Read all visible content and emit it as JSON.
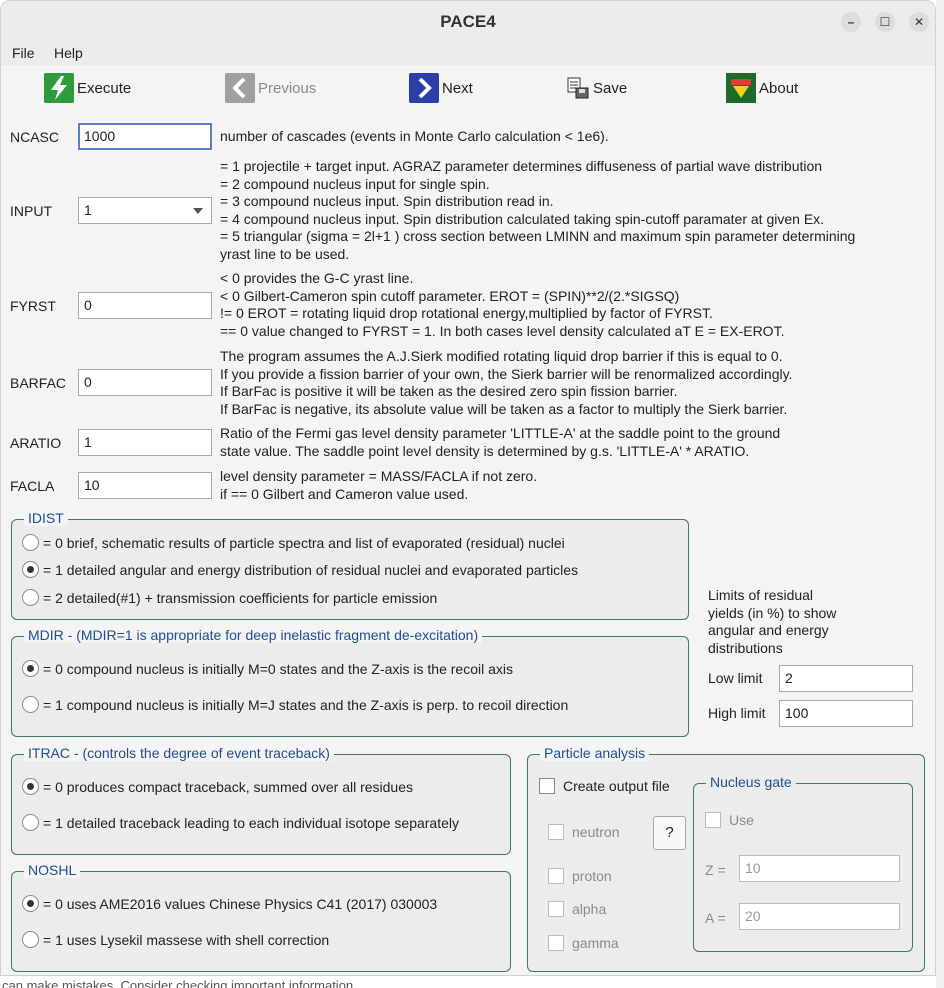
{
  "window": {
    "title": "PACE4",
    "min": "–",
    "max": "☐",
    "close": "✕"
  },
  "menu": {
    "file": "File",
    "help": "Help"
  },
  "toolbar": {
    "execute": "Execute",
    "previous": "Previous",
    "next": "Next",
    "save": "Save",
    "about": "About"
  },
  "params": {
    "ncasc": {
      "label": "NCASC",
      "value": "1000",
      "desc": "number of cascades (events in Monte Carlo calculation < 1e6)."
    },
    "input": {
      "label": "INPUT",
      "value": "1",
      "desc": [
        "= 1 projectile + target input. AGRAZ parameter determines diffuseness of partial wave distribution",
        "= 2 compound nucleus input for single spin.",
        "= 3 compound nucleus input. Spin distribution read in.",
        "= 4 compound nucleus input. Spin distribution calculated taking spin-cutoff paramater at given Ex.",
        "= 5 triangular (sigma = 2l+1 ) cross section between LMINN and maximum spin parameter determining",
        "yrast line to be used."
      ]
    },
    "fyrst": {
      "label": "FYRST",
      "value": "0",
      "desc": [
        "< 0 provides the G-C yrast line.",
        "< 0 Gilbert-Cameron spin cutoff parameter. EROT = (SPIN)**2/(2.*SIGSQ)",
        "!= 0 EROT = rotating liquid drop rotational energy,multiplied by factor of FYRST.",
        "== 0 value changed to FYRST = 1. In both cases level density calculated aT E = EX-EROT."
      ]
    },
    "barfac": {
      "label": "BARFAC",
      "value": "0",
      "desc": [
        "The program assumes the A.J.Sierk modified rotating liquid drop barrier if this is equal to 0.",
        "If you provide a fission barrier of your own, the Sierk barrier will be renormalized accordingly.",
        "If BarFac is positive it will be taken as the desired zero spin fission barrier.",
        "If BarFac is negative, its absolute value will be taken as a factor to multiply the Sierk barrier."
      ]
    },
    "aratio": {
      "label": "ARATIO",
      "value": "1",
      "desc": [
        "Ratio of the Fermi gas level density parameter 'LITTLE-A' at the saddle point to the ground",
        "state value. The saddle point level density is determined by g.s. 'LITTLE-A' * ARATIO."
      ]
    },
    "facla": {
      "label": "FACLA",
      "value": "10",
      "desc": [
        "level density parameter = MASS/FACLA if not zero.",
        "if == 0 Gilbert and Cameron value used."
      ]
    }
  },
  "idist": {
    "title": "IDIST",
    "options": [
      "= 0 brief, schematic results of particle spectra and list of evaporated (residual) nuclei",
      "= 1 detailed angular and energy distribution of residual nuclei and evaporated particles",
      "= 2 detailed(#1) + transmission coefficients for particle emission"
    ],
    "selected": 1
  },
  "mdir": {
    "title": "MDIR -  (MDIR=1 is appropriate for deep inelastic fragment de-excitation)",
    "options": [
      "= 0 compound nucleus is initially M=0 states and the Z-axis is the recoil axis",
      "= 1 compound nucleus is initially M=J states and the Z-axis is perp. to recoil direction"
    ],
    "selected": 0
  },
  "itrac": {
    "title": "ITRAC -  (controls the degree of event traceback)",
    "options": [
      "= 0 produces compact traceback, summed over all residues",
      "= 1 detailed traceback leading to each individual isotope separately"
    ],
    "selected": 0
  },
  "noshl": {
    "title": "NOSHL",
    "options": [
      "= 0 uses AME2016 values Chinese Physics C41 (2017) 030003",
      "= 1 uses Lysekil massese with shell correction"
    ],
    "selected": 0
  },
  "limits": {
    "desc": [
      "Limits of residual",
      "yields (in %) to show",
      "angular and energy",
      "distributions"
    ],
    "low_label": "Low limit",
    "low_value": "2",
    "high_label": "High limit",
    "high_value": "100"
  },
  "particle": {
    "title": "Particle analysis",
    "create_output": "Create output file",
    "neutron": "neutron",
    "proton": "proton",
    "alpha": "alpha",
    "gamma": "gamma",
    "help": "?",
    "gate": {
      "title": "Nucleus gate",
      "use": "Use",
      "z_label": "Z =",
      "z_value": "10",
      "a_label": "A =",
      "a_value": "20"
    }
  },
  "footer": "can make mistakes. Consider checking important information.",
  "colors": {
    "execute_icon": "#2e9a3c",
    "next_icon": "#2b3fa8",
    "previous_icon": "#a0a0a0",
    "group_border": "#3f7a5a",
    "group_title": "#1f4f8f"
  }
}
